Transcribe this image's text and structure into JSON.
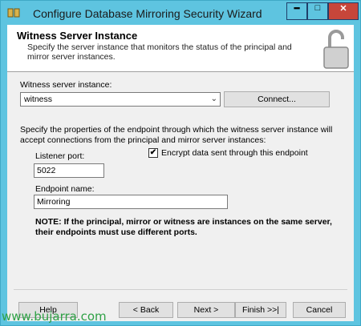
{
  "window": {
    "title": "Configure Database Mirroring Security Wizard",
    "controls": {
      "minimize": "━",
      "maximize": "□",
      "close": "✕"
    }
  },
  "header": {
    "title": "Witness Server Instance",
    "description": "Specify the server instance that monitors the status of the principal and mirror server instances."
  },
  "witness": {
    "label": "Witness server instance:",
    "value": "witness",
    "connect_label": "Connect..."
  },
  "endpoint": {
    "description": "Specify the properties of the endpoint through which the witness server instance will accept connections from the principal and mirror server instances:",
    "port_label": "Listener port:",
    "port_value": "5022",
    "encrypt_label": "Encrypt data sent through this endpoint",
    "encrypt_checked": true,
    "encrypt_mark": "✔",
    "name_label": "Endpoint name:",
    "name_value": "Mirroring",
    "note": "NOTE: If the principal, mirror or witness are instances on the same server, their endpoints must use different ports."
  },
  "footer": {
    "help": "Help",
    "back": "< Back",
    "next": "Next >",
    "finish": "Finish >>|",
    "cancel": "Cancel"
  },
  "watermark": "www.bujarra.com",
  "icons": {
    "app": "database-icon",
    "lock": "lock-icon",
    "dropdown": "chevron-down-icon"
  },
  "colors": {
    "titlebar": "#5ec4e0",
    "close_button": "#c7463a",
    "watermark": "#2fa146"
  }
}
